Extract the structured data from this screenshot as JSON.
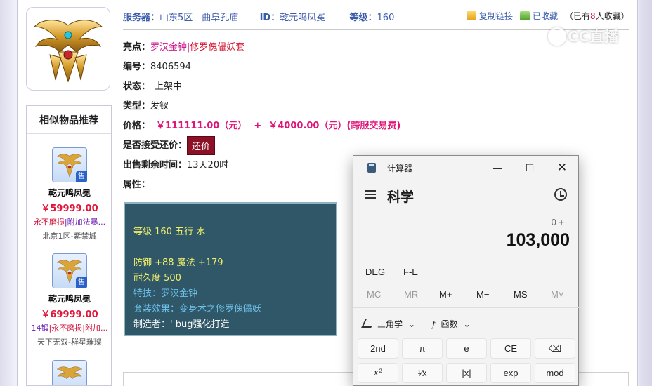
{
  "header": {
    "server_label": "服务器：",
    "server_value": "山东5区—曲阜孔庙",
    "id_label": "ID：",
    "id_value": "乾元鸣凤冕",
    "level_label": "等级：",
    "level_value": "160",
    "copy_link": "复制链接",
    "favorited": "已收藏",
    "fav_count_prefix": "（已有",
    "fav_count_num": "8",
    "fav_count_suffix": "人收藏）"
  },
  "details": {
    "highlight_label": "亮点：",
    "highlight_a": "罗汉金钟",
    "highlight_sep": "|",
    "highlight_b": "修罗傀儡妖套",
    "serial_label": "编号：",
    "serial_value": "8406594",
    "status_label": "状态：",
    "status_value": "上架中",
    "type_label": "类型：",
    "type_value": "发钗",
    "price_label": "价格：",
    "price_value": "￥111111.00（元）",
    "price_plus": "+",
    "fee_value": "￥4000.00（元）(跨服交易费)",
    "bargain_label": "是否接受还价：",
    "bargain_button": "还价",
    "remaining_label": "出售剩余时间：",
    "remaining_value": "13天20时",
    "attr_label": "属性："
  },
  "attributes": {
    "line1": "等级 160 五行 水",
    "line2": "防御 +88 魔法 +179",
    "line3": "耐久度 500",
    "line4": "特技：罗汉金钟",
    "line5": "套装效果：变身术之修罗傀儡妖",
    "line6": "制造者：' bug强化打造"
  },
  "recommend": {
    "title": "相似物品推荐",
    "badge": "售",
    "items": [
      {
        "name": "乾元鸣凤冕",
        "price": "￥59999.00",
        "tag_a": "永不磨损",
        "tag_b": "|附加法暴...",
        "server": "北京1区-紫禁城"
      },
      {
        "name": "乾元鸣凤冕",
        "price": "￥69999.00",
        "tag_a": "14锻",
        "tag_b": "|永不磨损|附加...",
        "server": "天下无双-群星璀璨"
      }
    ]
  },
  "watermark": "CC直播",
  "calculator": {
    "title": "计算器",
    "mode": "科学",
    "expression": "0 +",
    "result": "103,000",
    "deg": "DEG",
    "fe": "F-E",
    "mem": [
      "MC",
      "MR",
      "M+",
      "M−",
      "MS",
      "M˅"
    ],
    "trig": "三角学",
    "func": "函数",
    "keys_row1": [
      "2nd",
      "π",
      "e",
      "CE",
      "⌫"
    ],
    "keys_row2": [
      "x²",
      "¹⁄x",
      "|x|",
      "exp",
      "mod"
    ]
  },
  "colors": {
    "accent_blue": "#3b5bab",
    "price_pink": "#e01478",
    "bargain_bg": "#8c1026",
    "attr_bg": "#2f5767"
  }
}
